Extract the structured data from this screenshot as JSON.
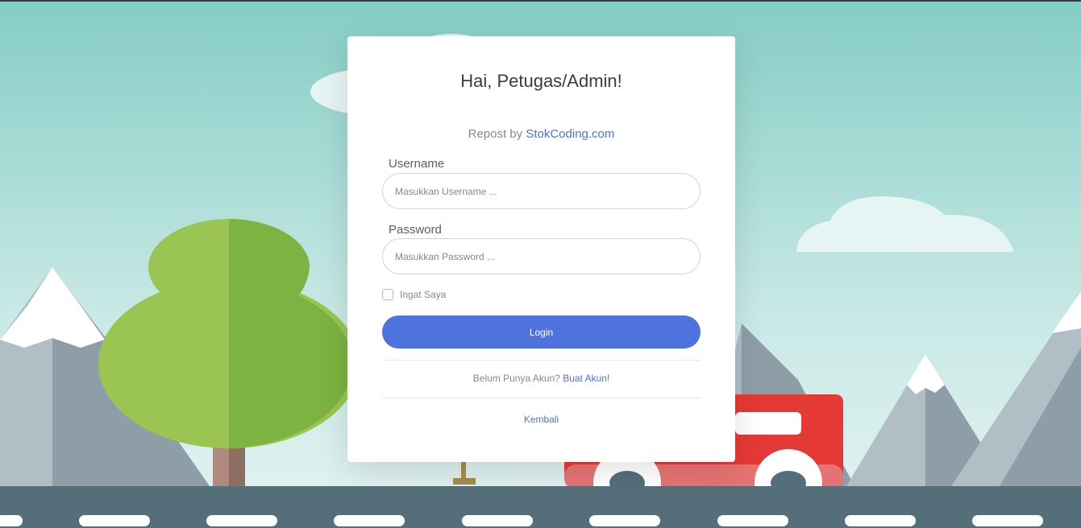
{
  "login": {
    "title": "Hai, Petugas/Admin!",
    "repost_prefix": "Repost by",
    "repost_link": "StokCoding.com",
    "username_label": "Username",
    "username_placeholder": "Masukkan Username ...",
    "password_label": "Password",
    "password_placeholder": "Masukkan Password ...",
    "remember_label": "Ingat Saya",
    "login_button": "Login",
    "register_prompt": "Belum Punya Akun?",
    "register_link": "Buat Akun!",
    "back_link": "Kembali"
  },
  "colors": {
    "primary": "#4e73df",
    "sky": "#8fd0c9",
    "road": "#546e7a",
    "truck": "#e53935",
    "tree_light": "#9bc553",
    "tree_dark": "#7cb342"
  }
}
